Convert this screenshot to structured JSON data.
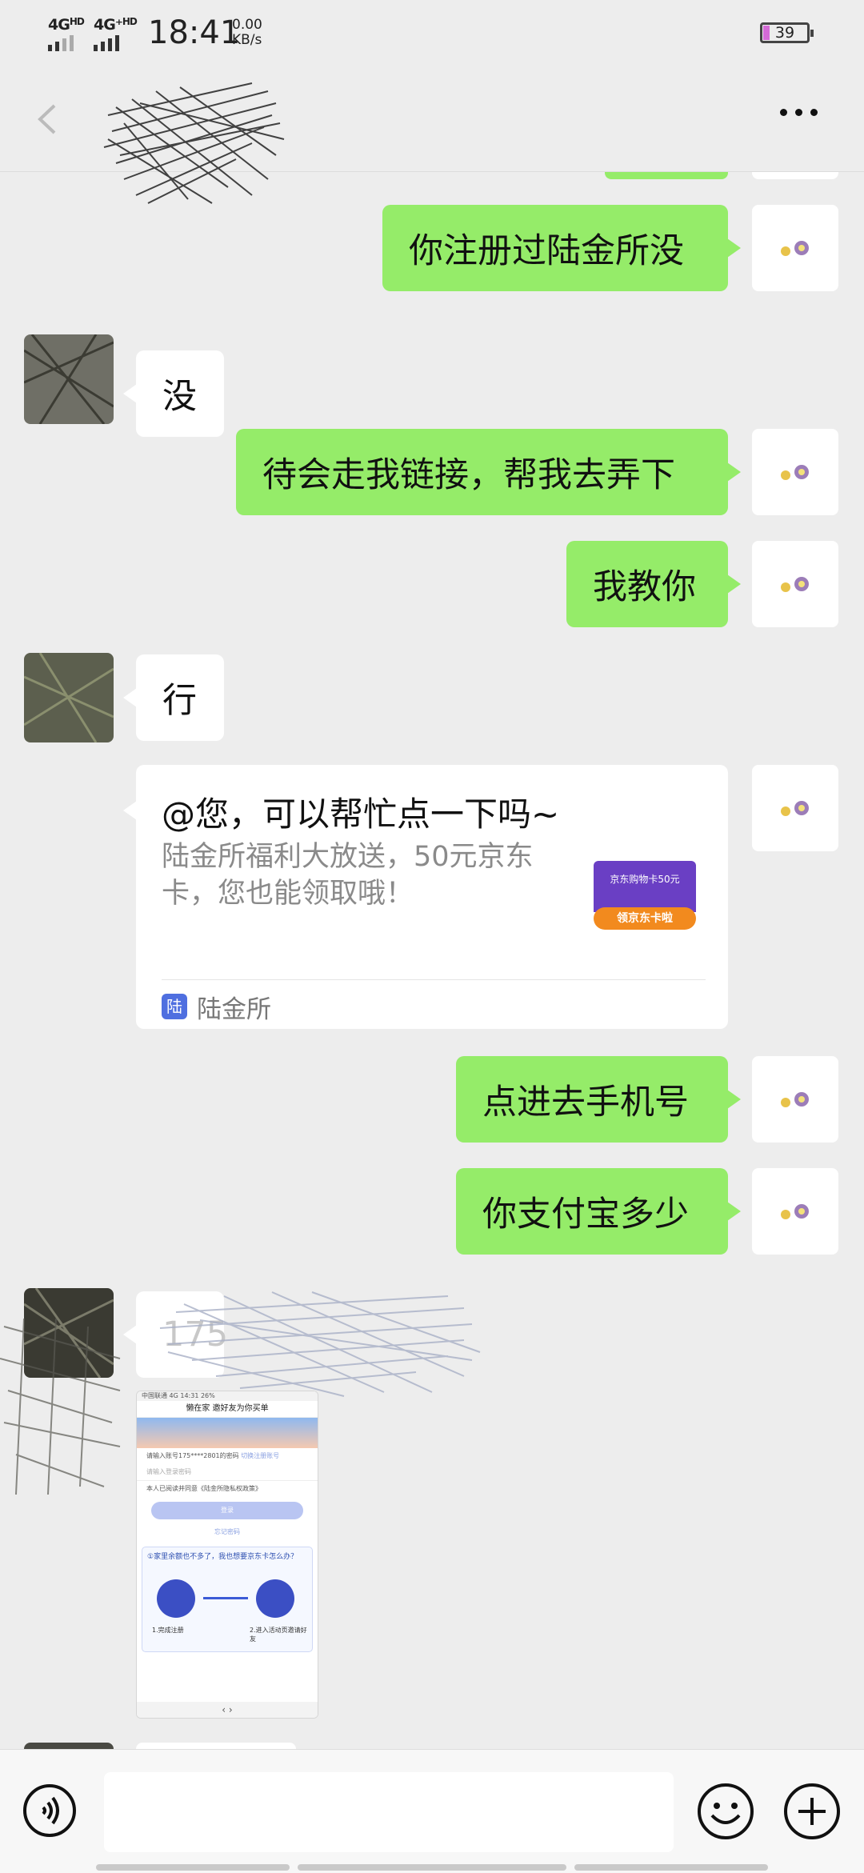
{
  "status_bar": {
    "network1": "4G",
    "network1_sup": "HD",
    "network2": "4G⁺",
    "network2_sup": "HD",
    "time": "18:41",
    "speed_value": "0.00",
    "speed_unit": "KB/s",
    "battery": "39"
  },
  "nav": {
    "back_icon": "chevron-left-icon",
    "more_icon": "more-dots-icon"
  },
  "messages": [
    {
      "side": "out",
      "text": "你注册过陆金所没"
    },
    {
      "side": "in",
      "text": "没"
    },
    {
      "side": "out",
      "text": "待会走我链接，帮我去弄下"
    },
    {
      "side": "out",
      "text": "我教你"
    },
    {
      "side": "in",
      "text": "行"
    },
    {
      "side": "out",
      "text": "点进去手机号"
    },
    {
      "side": "out",
      "text": "你支付宝多少"
    },
    {
      "side": "in",
      "text": "175"
    }
  ],
  "link_card": {
    "title": "@您，可以帮忙点一下吗~",
    "description": "陆金所福利大放送，50元京东卡，您也能领取哦！",
    "source": "陆金所",
    "source_icon_text": "陆",
    "thumb_top": "京东购物卡50元",
    "thumb_button": "领京东卡啦"
  },
  "screenshot": {
    "status": "中国联通 4G          14:31           26%",
    "header": "懒在家 邀好友为你买单",
    "account_prompt": "请输入账号175****2801的密码",
    "switch_account": "切换注册账号",
    "password_placeholder": "请输入登录密码",
    "agreement": "本人已阅读并同意《陆金所隐私权政策》",
    "login_button": "登录",
    "forgot": "忘记密码",
    "question": "①家里余额也不多了，我也想要京东卡怎么办？",
    "step1": "1.完成注册",
    "step2": "2.进入活动页邀请好友",
    "nav": "‹        ›"
  },
  "input_bar": {
    "voice_icon": "voice-icon",
    "emoji_icon": "emoji-icon",
    "plus_icon": "plus-icon",
    "input_value": ""
  },
  "colors": {
    "outgoing_bubble": "#95ec69",
    "incoming_bubble": "#ffffff",
    "background": "#ededed"
  }
}
